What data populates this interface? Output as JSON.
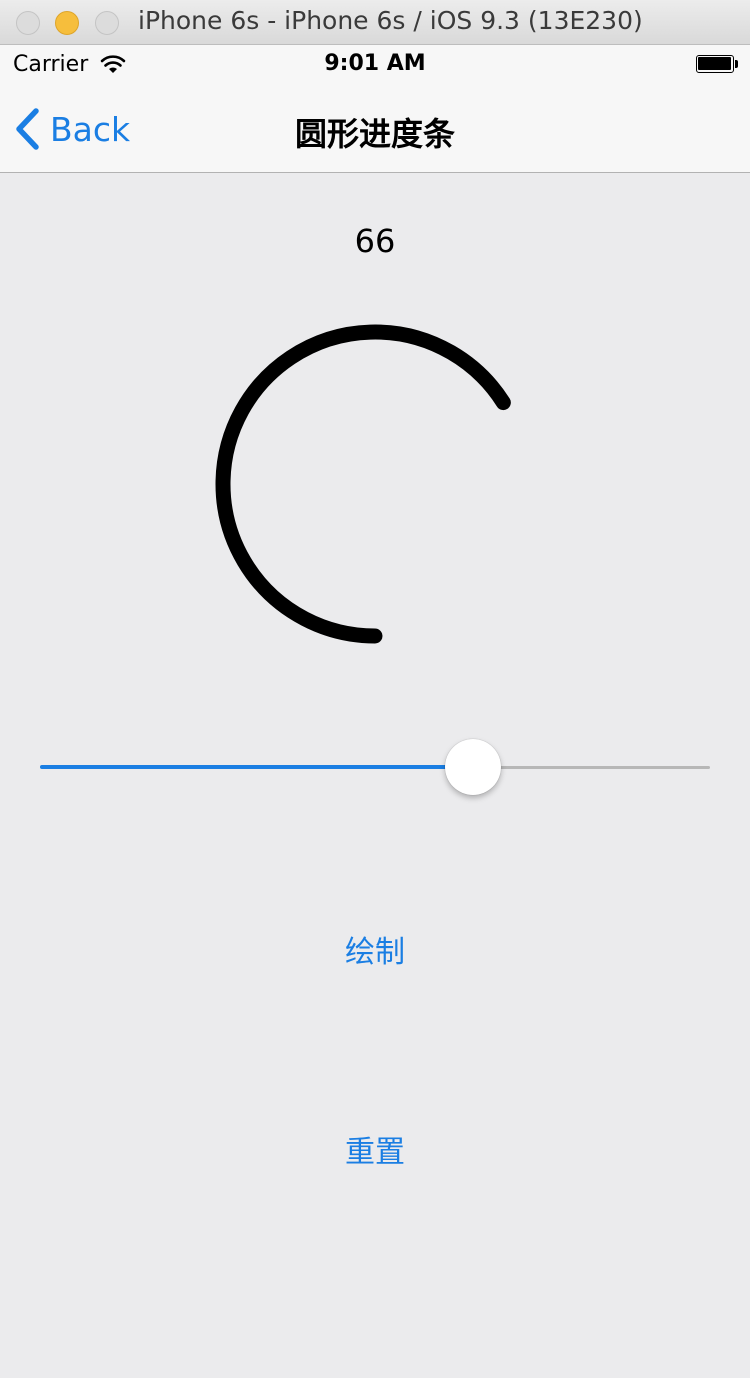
{
  "window": {
    "title": "iPhone 6s - iPhone 6s / iOS 9.3 (13E230)"
  },
  "status_bar": {
    "carrier": "Carrier",
    "time": "9:01 AM"
  },
  "nav": {
    "back_label": "Back",
    "title": "圆形进度条"
  },
  "progress": {
    "value_label": "66",
    "fraction": 0.66
  },
  "slider": {
    "fraction": 0.66
  },
  "buttons": {
    "draw": "绘制",
    "reset": "重置"
  },
  "colors": {
    "accent": "#1a7ee3",
    "background": "#ebebed",
    "ring": "#000000"
  }
}
